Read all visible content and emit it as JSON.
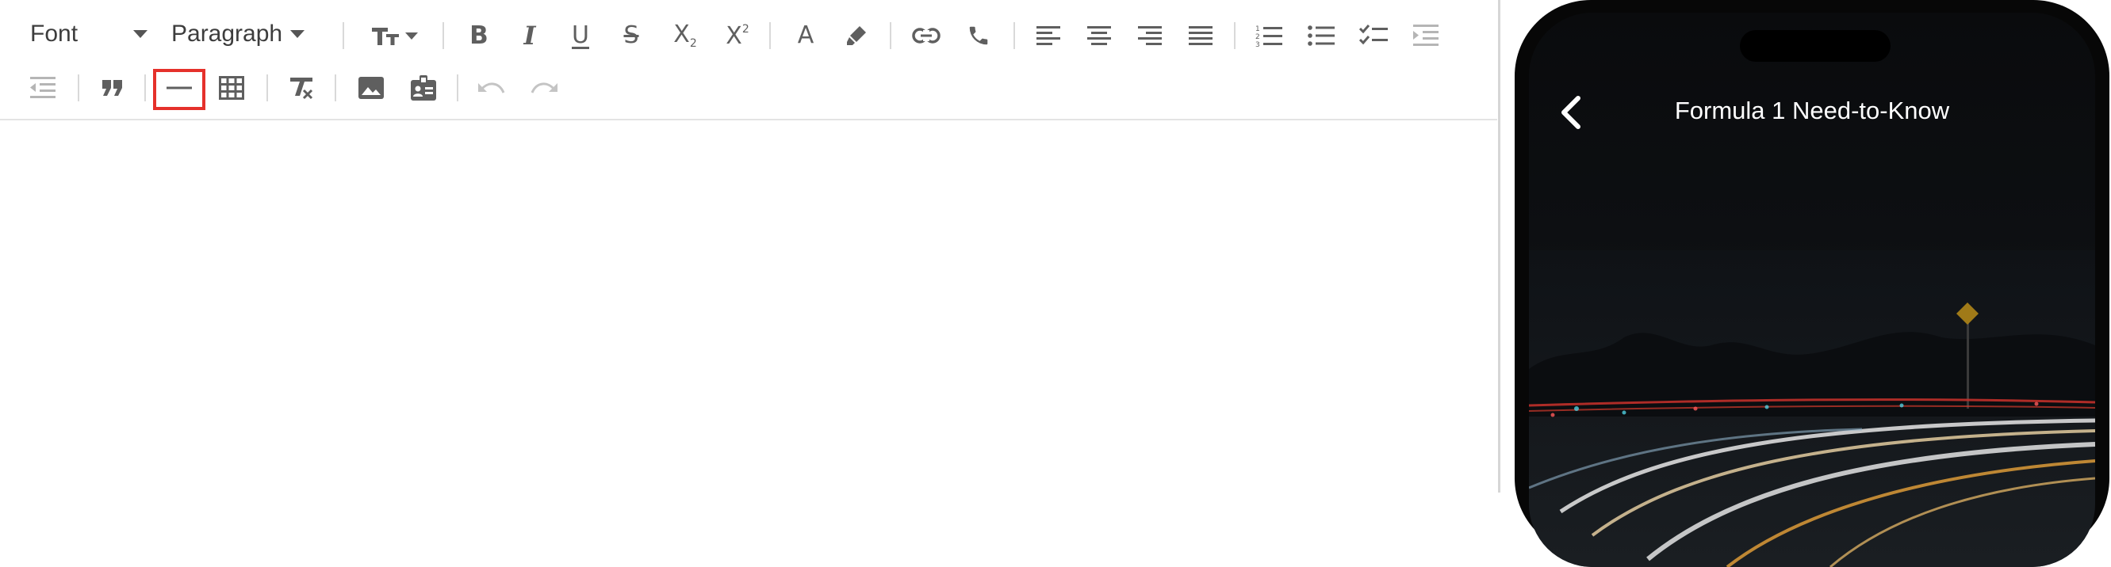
{
  "toolbar": {
    "font_label": "Font",
    "paragraph_label": "Paragraph",
    "buttons": [
      {
        "name": "font-size-icon"
      },
      {
        "name": "bold-icon"
      },
      {
        "name": "italic-icon"
      },
      {
        "name": "underline-icon"
      },
      {
        "name": "strikethrough-icon"
      },
      {
        "name": "subscript-icon"
      },
      {
        "name": "superscript-icon"
      },
      {
        "name": "font-color-icon"
      },
      {
        "name": "highlight-icon"
      },
      {
        "name": "link-icon"
      },
      {
        "name": "phone-icon"
      },
      {
        "name": "align-left-icon"
      },
      {
        "name": "align-center-icon"
      },
      {
        "name": "align-right-icon"
      },
      {
        "name": "justify-icon"
      },
      {
        "name": "ordered-list-icon"
      },
      {
        "name": "bullet-list-icon"
      },
      {
        "name": "checklist-icon"
      },
      {
        "name": "indent-icon"
      },
      {
        "name": "outdent-icon"
      },
      {
        "name": "blockquote-icon"
      },
      {
        "name": "horizontal-rule-icon",
        "highlighted": true
      },
      {
        "name": "table-icon"
      },
      {
        "name": "clear-format-icon"
      },
      {
        "name": "image-icon"
      },
      {
        "name": "contact-card-icon"
      },
      {
        "name": "undo-icon",
        "disabled": true
      },
      {
        "name": "redo-icon",
        "disabled": true
      }
    ],
    "highlight_color": "#e5312b"
  },
  "editor": {
    "content": ""
  },
  "phone": {
    "title": "Formula 1 Need-to-Know"
  }
}
